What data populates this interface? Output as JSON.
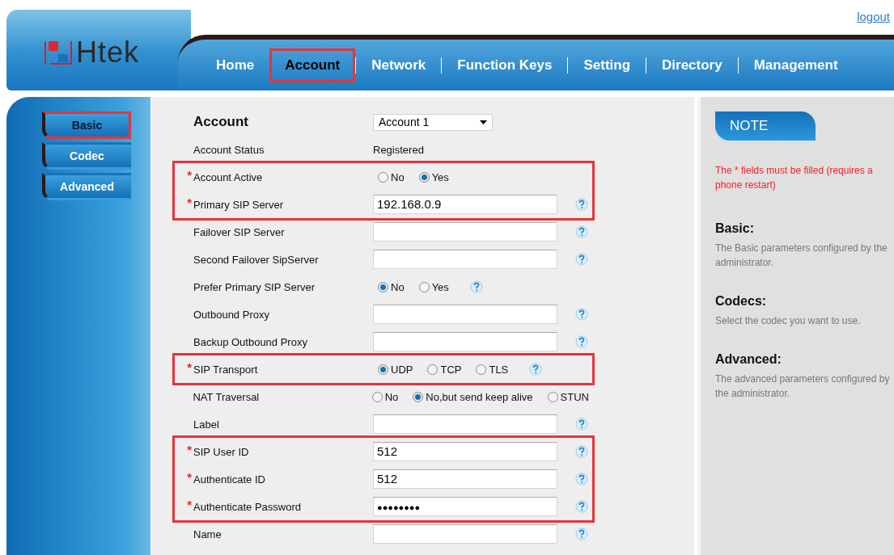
{
  "logout": "logout",
  "logo": {
    "text": "Htek"
  },
  "nav": [
    {
      "label": "Home",
      "selected": false,
      "highlighted": false
    },
    {
      "label": "Account",
      "selected": true,
      "highlighted": true
    },
    {
      "label": "Network",
      "selected": false,
      "highlighted": false
    },
    {
      "label": "Function Keys",
      "selected": false,
      "highlighted": false
    },
    {
      "label": "Setting",
      "selected": false,
      "highlighted": false
    },
    {
      "label": "Directory",
      "selected": false,
      "highlighted": false
    },
    {
      "label": "Management",
      "selected": false,
      "highlighted": false
    }
  ],
  "sidebar": {
    "items": [
      {
        "label": "Basic",
        "selected": true,
        "highlighted": true
      },
      {
        "label": "Codec",
        "selected": false,
        "highlighted": false
      },
      {
        "label": "Advanced",
        "selected": false,
        "highlighted": false
      }
    ]
  },
  "form": {
    "groups": [
      {
        "highlighted": false,
        "rows": [
          {
            "kind": "select",
            "label": "Account",
            "help": false,
            "value": "Account 1"
          },
          {
            "kind": "text",
            "label": "Account Status",
            "help": false,
            "value": "Registered"
          }
        ]
      },
      {
        "highlighted": true,
        "rows": [
          {
            "kind": "radio",
            "label": "Account Active",
            "asterisk": "*",
            "help": false,
            "options": [
              {
                "label": "No",
                "selected": false
              },
              {
                "label": "Yes",
                "selected": true
              }
            ]
          },
          {
            "kind": "input",
            "label": "Primary SIP Server",
            "asterisk": "*",
            "help": true,
            "value": "192.168.0.9"
          }
        ]
      },
      {
        "highlighted": false,
        "rows": [
          {
            "kind": "input",
            "label": "Failover SIP Server",
            "help": true
          },
          {
            "kind": "input",
            "label": "Second Failover SipServer",
            "help": true
          },
          {
            "kind": "radio",
            "label": "Prefer Primary SIP Server",
            "help": true,
            "options": [
              {
                "label": "No",
                "selected": true
              },
              {
                "label": "Yes",
                "selected": false
              }
            ]
          },
          {
            "kind": "input",
            "label": "Outbound Proxy",
            "help": true
          },
          {
            "kind": "input",
            "label": "Backup Outbound Proxy",
            "help": true
          }
        ]
      },
      {
        "highlighted": true,
        "rows": [
          {
            "kind": "radio",
            "label": "SIP Transport",
            "asterisk": "*",
            "help": true,
            "options": [
              {
                "label": "UDP",
                "selected": true
              },
              {
                "label": "TCP",
                "selected": false
              },
              {
                "label": "TLS",
                "selected": false
              }
            ]
          }
        ]
      },
      {
        "highlighted": false,
        "rows": [
          {
            "kind": "radio",
            "label": "NAT Traversal",
            "help": false,
            "options": [
              {
                "label": "No",
                "selected": false
              },
              {
                "label": "No,but send keep alive",
                "selected": true
              },
              {
                "label": "STUN",
                "selected": false
              }
            ]
          },
          {
            "kind": "input",
            "label": "Label",
            "help": true
          }
        ]
      },
      {
        "highlighted": true,
        "rows": [
          {
            "kind": "input",
            "label": "SIP User ID",
            "asterisk": "*",
            "help": true,
            "value": "512"
          },
          {
            "kind": "input",
            "label": "Authenticate ID",
            "asterisk": "*",
            "help": true,
            "value": "512"
          },
          {
            "kind": "password",
            "label": "Authenticate Password",
            "asterisk": "*",
            "help": true,
            "value": "●●●●●●●●"
          }
        ]
      },
      {
        "highlighted": false,
        "rows": [
          {
            "kind": "input",
            "label": "Name",
            "help": true
          }
        ]
      }
    ]
  },
  "note": {
    "title": "NOTE",
    "warning": "The * fields must be filled (requires a phone restart)",
    "sections": [
      {
        "heading": "Basic:",
        "text": "The Basic parameters configured by the administrator."
      },
      {
        "heading": "Codecs:",
        "text": "Select the codec you want to use."
      },
      {
        "heading": "Advanced:",
        "text": "The advanced parameters configured by the administrator."
      }
    ]
  }
}
